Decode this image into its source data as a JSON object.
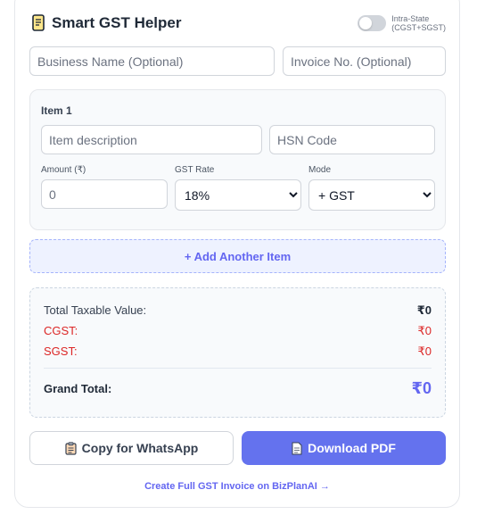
{
  "header": {
    "title": "Smart GST Helper",
    "toggle_label_line1": "Intra-State",
    "toggle_label_line2": "(CGST+SGST)",
    "toggle_on": false
  },
  "business": {
    "business_placeholder": "Business Name (Optional)",
    "invoice_placeholder": "Invoice No. (Optional)"
  },
  "item": {
    "title": "Item 1",
    "description_placeholder": "Item description",
    "hsn_placeholder": "HSN Code",
    "amount_label": "Amount (₹)",
    "amount_placeholder": "0",
    "gst_rate_label": "GST Rate",
    "gst_rate_value": "18%",
    "mode_label": "Mode",
    "mode_value": "+ GST"
  },
  "add_item_label": "+ Add Another Item",
  "totals": {
    "taxable_label": "Total Taxable Value:",
    "taxable_value": "₹0",
    "cgst_label": "CGST:",
    "cgst_value": "₹0",
    "sgst_label": "SGST:",
    "sgst_value": "₹0",
    "grand_label": "Grand Total:",
    "grand_value": "₹0"
  },
  "buttons": {
    "copy_label": "Copy for WhatsApp",
    "pdf_label": "Download PDF"
  },
  "footer_link": "Create Full GST Invoice on BizPlanAI →",
  "colors": {
    "accent": "#6366f1",
    "tax_red": "#dc2626"
  },
  "icons": [
    "scroll-icon",
    "clipboard-icon",
    "document-icon"
  ]
}
